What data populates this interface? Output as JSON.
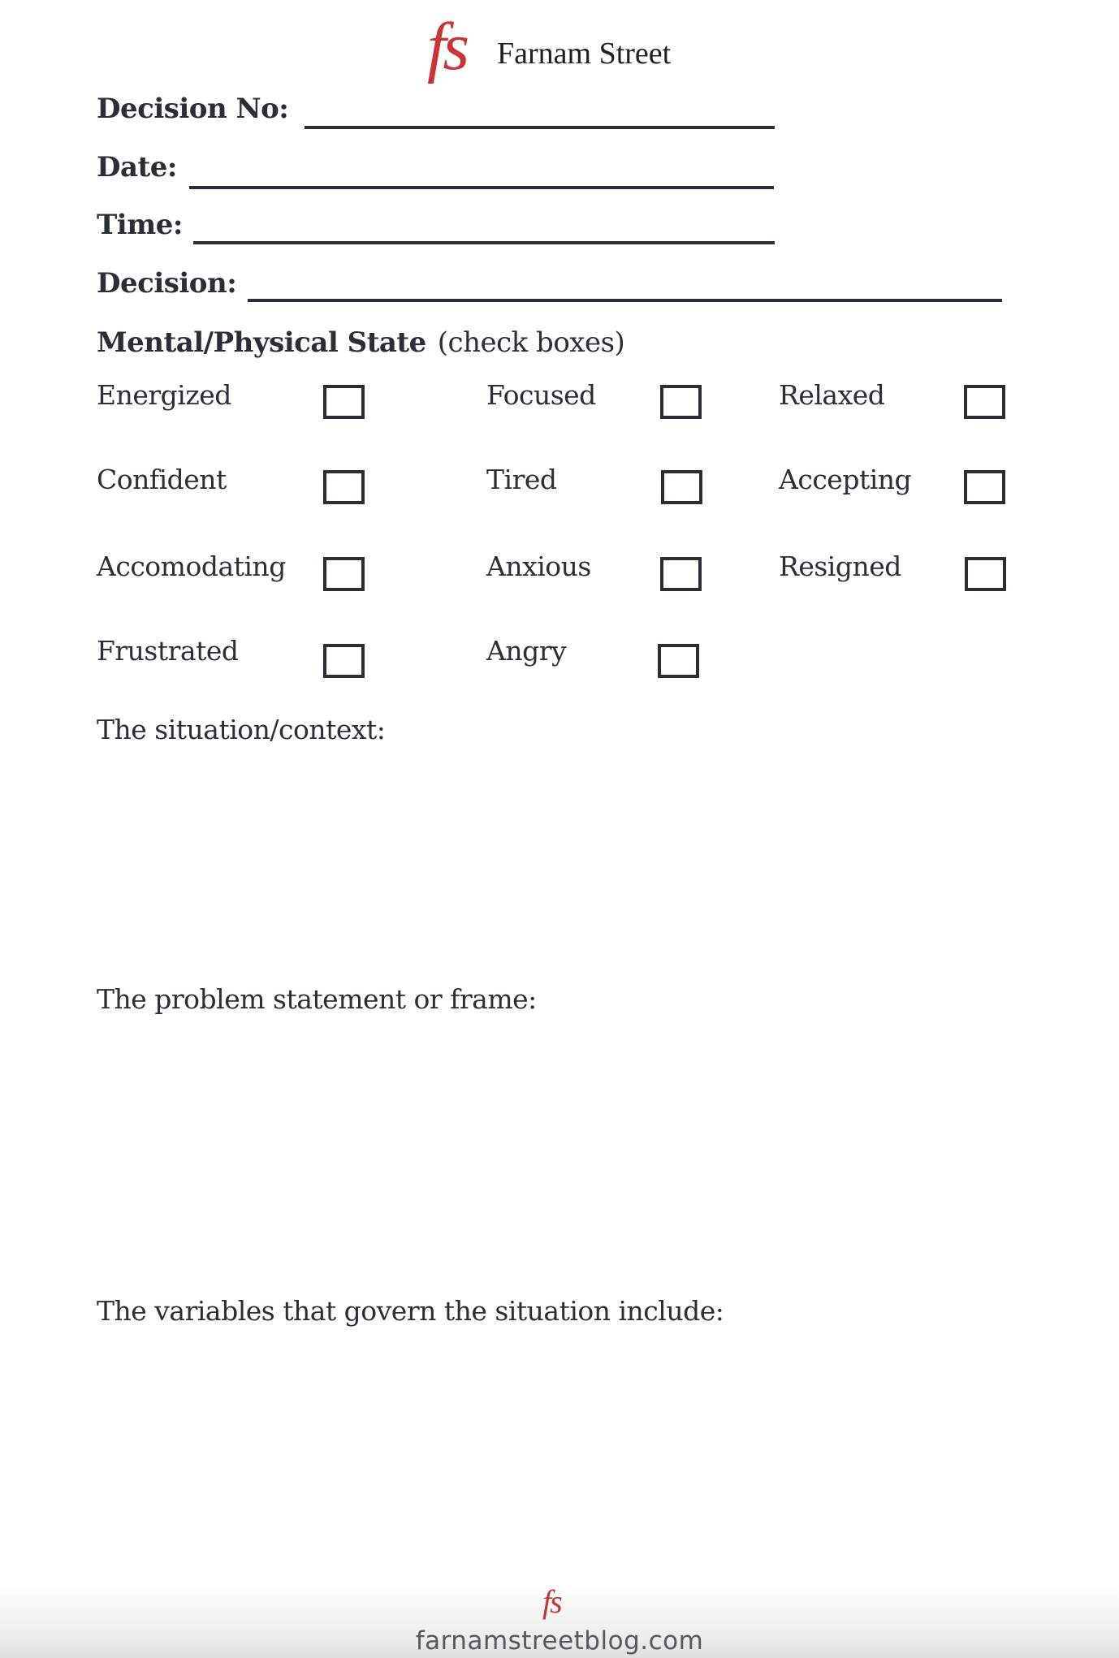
{
  "header": {
    "logo_mark": "fs",
    "brand_name": "Farnam Street",
    "brand_color": "#cc3333"
  },
  "fields": {
    "decision_no": {
      "label": "Decision No:",
      "value": ""
    },
    "date": {
      "label": "Date:",
      "value": ""
    },
    "time": {
      "label": "Time:",
      "value": ""
    },
    "decision": {
      "label": "Decision:",
      "value": ""
    }
  },
  "mental_state": {
    "title": "Mental/Physical State",
    "hint": "(check boxes)",
    "options": [
      {
        "label": "Energized",
        "checked": false
      },
      {
        "label": "Focused",
        "checked": false
      },
      {
        "label": "Relaxed",
        "checked": false
      },
      {
        "label": "Confident",
        "checked": false
      },
      {
        "label": "Tired",
        "checked": false
      },
      {
        "label": "Accepting",
        "checked": false
      },
      {
        "label": "Accomodating",
        "checked": false
      },
      {
        "label": "Anxious",
        "checked": false
      },
      {
        "label": "Resigned",
        "checked": false
      },
      {
        "label": "Frustrated",
        "checked": false
      },
      {
        "label": "Angry",
        "checked": false
      }
    ]
  },
  "prompts": {
    "situation": {
      "label": "The situation/context:",
      "value": ""
    },
    "problem": {
      "label": "The problem statement or frame:",
      "value": ""
    },
    "variables": {
      "label": "The variables that govern the situation include:",
      "value": ""
    }
  },
  "footer": {
    "logo_mark": "fs",
    "url": "farnamstreetblog.com"
  },
  "colors": {
    "text": "#2b2e36",
    "accent": "#cc3333",
    "footer_text": "#57585c"
  }
}
